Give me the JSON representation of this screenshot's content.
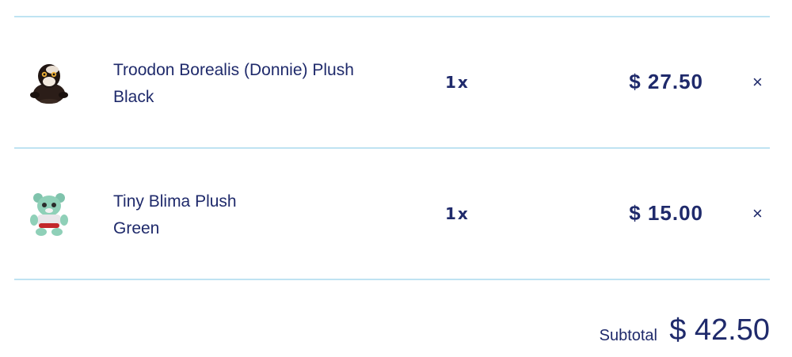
{
  "cart": {
    "items": [
      {
        "name": "Troodon Borealis (Donnie) Plush",
        "variant": "Black",
        "quantity": "1x",
        "price": "$ 27.50",
        "remove_icon": "×",
        "thumbnail_icon": "troodon-plush-image"
      },
      {
        "name": "Tiny Blima Plush",
        "variant": "Green",
        "quantity": "1x",
        "price": "$ 15.00",
        "remove_icon": "×",
        "thumbnail_icon": "blima-plush-image"
      }
    ],
    "subtotal_label": "Subtotal",
    "subtotal_value": "$ 42.50"
  },
  "colors": {
    "text": "#1f2a6b",
    "divider": "#bfe3f2"
  }
}
